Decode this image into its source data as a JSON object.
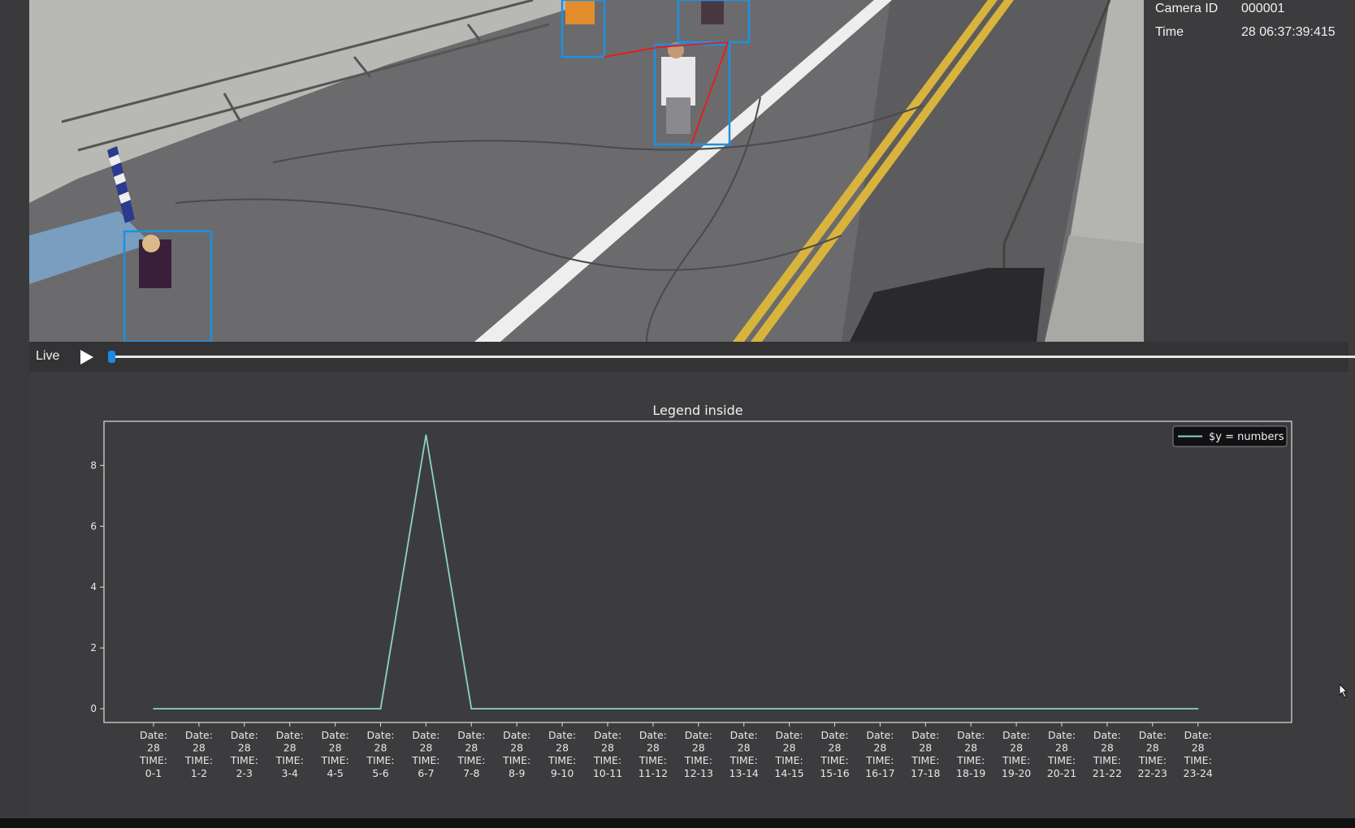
{
  "camera_info": {
    "camera_id_label": "Camera ID",
    "camera_id": "000001",
    "time_label": "Time",
    "time_value": "28 06:37:39:415"
  },
  "player": {
    "live_label": "Live",
    "play_icon": "play-icon",
    "progress": 0.0
  },
  "video": {
    "description_icon": "camera-feed",
    "box_color": "#1e90e0",
    "link_color": "#e02020"
  },
  "chart_data": {
    "type": "line",
    "title": "Legend inside",
    "xlabel": "",
    "ylabel": "",
    "categories": [
      "Date: 28 TIME: 0-1",
      "Date: 28 TIME: 1-2",
      "Date: 28 TIME: 2-3",
      "Date: 28 TIME: 3-4",
      "Date: 28 TIME: 4-5",
      "Date: 28 TIME: 5-6",
      "Date: 28 TIME: 6-7",
      "Date: 28 TIME: 7-8",
      "Date: 28 TIME: 8-9",
      "Date: 28 TIME: 9-10",
      "Date: 28 TIME: 10-11",
      "Date: 28 TIME: 11-12",
      "Date: 28 TIME: 12-13",
      "Date: 28 TIME: 13-14",
      "Date: 28 TIME: 14-15",
      "Date: 28 TIME: 15-16",
      "Date: 28 TIME: 16-17",
      "Date: 28 TIME: 17-18",
      "Date: 28 TIME: 18-19",
      "Date: 28 TIME: 19-20",
      "Date: 28 TIME: 20-21",
      "Date: 28 TIME: 21-22",
      "Date: 28 TIME: 22-23",
      "Date: 28 TIME: 23-24"
    ],
    "tick_lines": [
      [
        "Date:",
        "28",
        "TIME:",
        "0-1"
      ],
      [
        "Date:",
        "28",
        "TIME:",
        "1-2"
      ],
      [
        "Date:",
        "28",
        "TIME:",
        "2-3"
      ],
      [
        "Date:",
        "28",
        "TIME:",
        "3-4"
      ],
      [
        "Date:",
        "28",
        "TIME:",
        "4-5"
      ],
      [
        "Date:",
        "28",
        "TIME:",
        "5-6"
      ],
      [
        "Date:",
        "28",
        "TIME:",
        "6-7"
      ],
      [
        "Date:",
        "28",
        "TIME:",
        "7-8"
      ],
      [
        "Date:",
        "28",
        "TIME:",
        "8-9"
      ],
      [
        "Date:",
        "28",
        "TIME:",
        "9-10"
      ],
      [
        "Date:",
        "28",
        "TIME:",
        "10-11"
      ],
      [
        "Date:",
        "28",
        "TIME:",
        "11-12"
      ],
      [
        "Date:",
        "28",
        "TIME:",
        "12-13"
      ],
      [
        "Date:",
        "28",
        "TIME:",
        "13-14"
      ],
      [
        "Date:",
        "28",
        "TIME:",
        "14-15"
      ],
      [
        "Date:",
        "28",
        "TIME:",
        "15-16"
      ],
      [
        "Date:",
        "28",
        "TIME:",
        "16-17"
      ],
      [
        "Date:",
        "28",
        "TIME:",
        "17-18"
      ],
      [
        "Date:",
        "28",
        "TIME:",
        "18-19"
      ],
      [
        "Date:",
        "28",
        "TIME:",
        "19-20"
      ],
      [
        "Date:",
        "28",
        "TIME:",
        "20-21"
      ],
      [
        "Date:",
        "28",
        "TIME:",
        "21-22"
      ],
      [
        "Date:",
        "28",
        "TIME:",
        "22-23"
      ],
      [
        "Date:",
        "28",
        "TIME:",
        "23-24"
      ]
    ],
    "series": [
      {
        "name": "$y = numbers",
        "color": "#8fd3c0",
        "values": [
          0,
          0,
          0,
          0,
          0,
          0,
          9,
          0,
          0,
          0,
          0,
          0,
          0,
          0,
          0,
          0,
          0,
          0,
          0,
          0,
          0,
          0,
          0,
          0
        ]
      }
    ],
    "yticks": [
      0,
      2,
      4,
      6,
      8
    ],
    "ylim": [
      -0.45,
      9.45
    ],
    "grid": false,
    "legend": "upper right",
    "axis_color": "#e0e0e0",
    "background": "#3c3c3e"
  }
}
